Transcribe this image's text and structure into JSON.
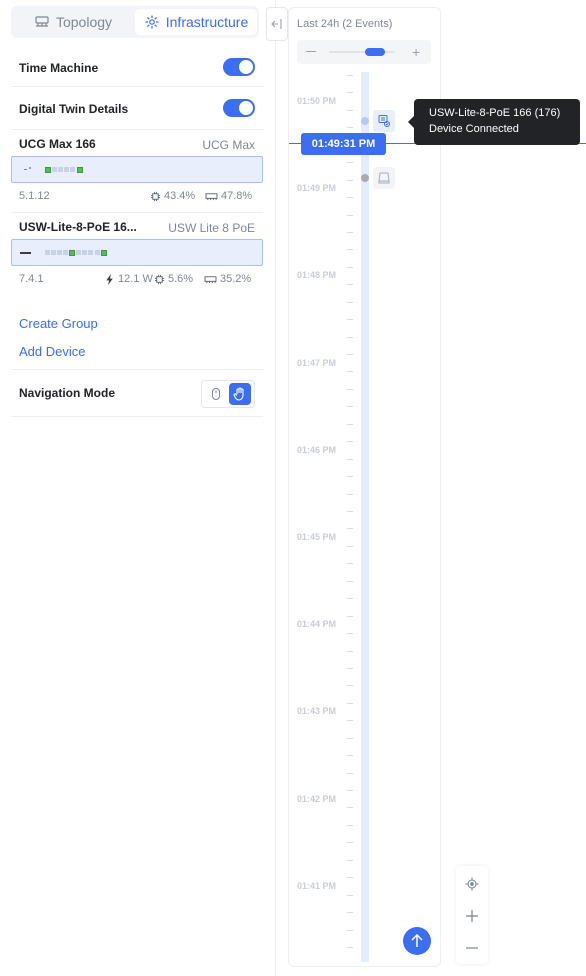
{
  "tabs": [
    {
      "label": "Topology",
      "icon": "topology-icon",
      "active": false
    },
    {
      "label": "Infrastructure",
      "icon": "infrastructure-icon",
      "active": true
    }
  ],
  "settings": {
    "time_machine_label": "Time Machine",
    "time_machine_on": true,
    "digital_twin_label": "Digital Twin Details",
    "digital_twin_on": true
  },
  "devices": [
    {
      "name": "UCG Max 166",
      "model": "UCG Max",
      "version": "5.1.12",
      "cpu": "43.4%",
      "memory": "47.8%",
      "power": "",
      "ports_active": [
        1,
        5
      ]
    },
    {
      "name": "USW-Lite-8-PoE 16...",
      "model": "USW Lite 8 PoE",
      "version": "7.4.1",
      "power": "12.1 W",
      "cpu": "5.6%",
      "memory": "35.2%",
      "ports_active": [
        3,
        8
      ]
    }
  ],
  "actions": {
    "create_group": "Create Group",
    "add_device": "Add Device"
  },
  "navigation": {
    "label": "Navigation Mode",
    "active_mode": "hand"
  },
  "timeline": {
    "title": "Last 24h (2 Events)",
    "current_time": "01:49:31 PM",
    "time_labels": [
      "01:50 PM",
      "01:49 PM",
      "01:48 PM",
      "01:47 PM",
      "01:46 PM",
      "01:45 PM",
      "01:44 PM",
      "01:43 PM",
      "01:42 PM",
      "01:41 PM"
    ],
    "zoom_level": 0.78
  },
  "tooltip": {
    "title": "USW-Lite-8-PoE 166 (176)",
    "subtitle": "Device Connected"
  },
  "colors": {
    "accent": "#3b6ef0",
    "port_active": "#5cb85c",
    "tooltip_bg": "#212327"
  }
}
